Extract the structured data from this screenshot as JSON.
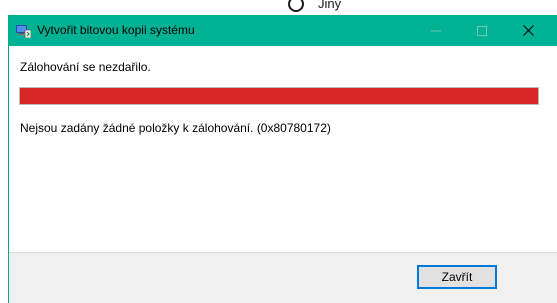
{
  "background_window": {
    "radio_label": "Jiný"
  },
  "dialog": {
    "title": "Vytvořit bitovou kopii systému",
    "status_heading": "Zálohování se nezdařilo.",
    "progress_fraction": 1.0,
    "progress_color": "#da2626",
    "error_message": "Nejsou zadány žádné položky k zálohování. (0x80780172)",
    "close_button_label": "Zavřít",
    "titlebar_color": "#00b294",
    "icons": {
      "app": "backup-app-icon",
      "minimize": "minimize-icon",
      "maximize": "maximize-icon",
      "close": "close-icon"
    }
  }
}
